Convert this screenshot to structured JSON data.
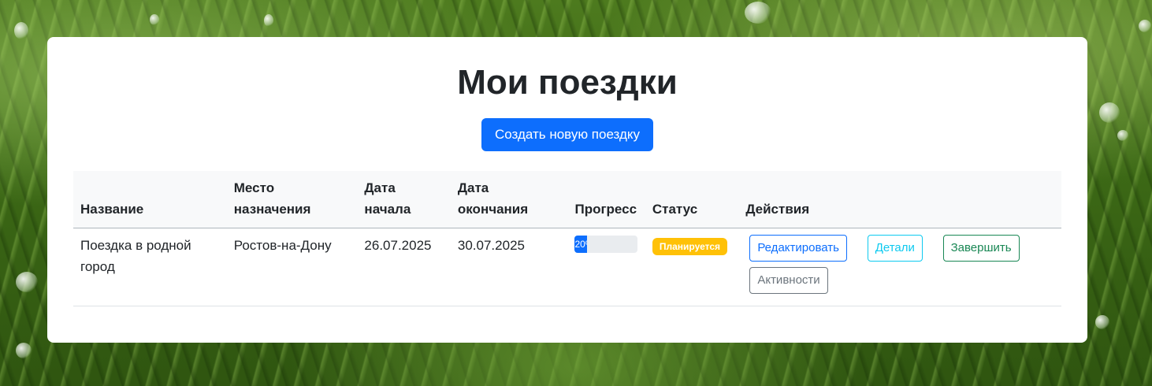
{
  "page": {
    "title": "Мои поездки",
    "create_button": "Создать новую поездку"
  },
  "table": {
    "headers": {
      "name": "Название",
      "destination": "Место назначения",
      "start_date": "Дата начала",
      "end_date": "Дата окончания",
      "progress": "Прогресс",
      "status": "Статус",
      "actions": "Действия"
    },
    "rows": [
      {
        "name": "Поездка в родной город",
        "destination": "Ростов-на-Дону",
        "start_date": "26.07.2025",
        "end_date": "30.07.2025",
        "progress_label": "20%",
        "progress_value": 20,
        "status": "Планируется",
        "actions": {
          "edit": "Редактировать",
          "details": "Детали",
          "complete": "Завершить",
          "activities": "Активности"
        }
      }
    ]
  },
  "colors": {
    "primary": "#0d6efd",
    "info": "#0dcaf0",
    "success": "#198754",
    "secondary": "#6c757d",
    "warning": "#ffc107"
  }
}
